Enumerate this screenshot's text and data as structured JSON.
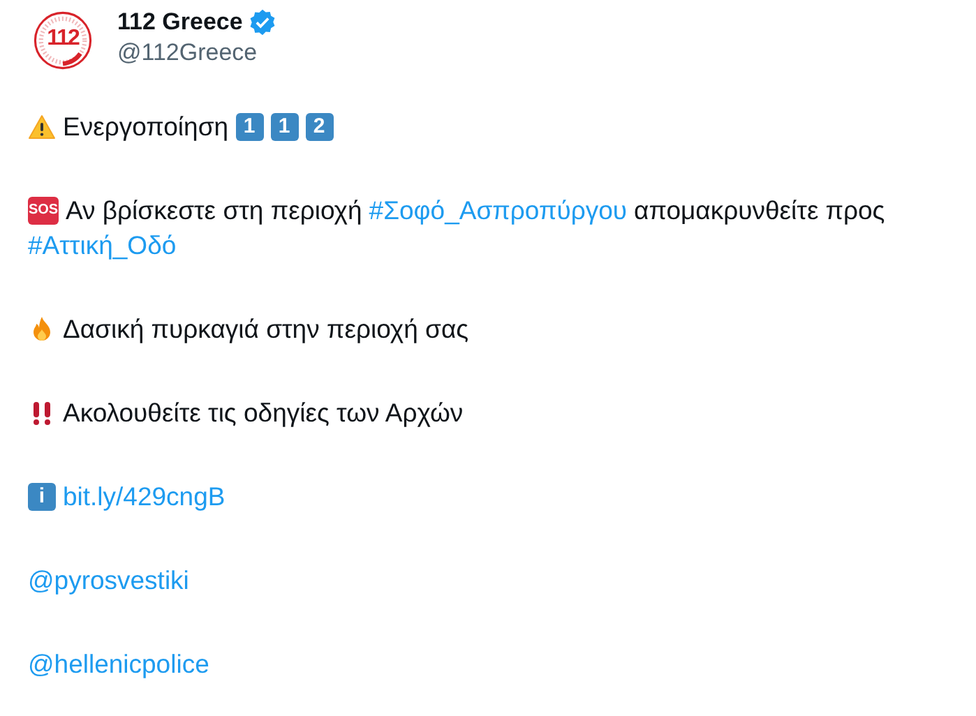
{
  "author": {
    "avatar_label": "112",
    "name": "112 Greece",
    "verified": true,
    "handle": "@112Greece"
  },
  "paragraphs": [
    {
      "segments": [
        {
          "kind": "warning"
        },
        {
          "kind": "text",
          "text": "Ενεργοποίηση"
        },
        {
          "kind": "keycap",
          "text": "1"
        },
        {
          "kind": "keycap",
          "text": "1"
        },
        {
          "kind": "keycap",
          "text": "2"
        }
      ]
    },
    {
      "segments": [
        {
          "kind": "sos",
          "text": "SOS"
        },
        {
          "kind": "text",
          "text": "Αν βρίσκεστε στη περιοχή"
        },
        {
          "kind": "link",
          "text": "#Σοφό_Ασπροπύργου"
        },
        {
          "kind": "text",
          "text": "απομακρυνθείτε"
        },
        {
          "kind": "text",
          "text": "προς"
        },
        {
          "kind": "link",
          "text": "#Αττική_Οδό"
        }
      ]
    },
    {
      "segments": [
        {
          "kind": "fire"
        },
        {
          "kind": "text",
          "text": "Δασική πυρκαγιά στην περιοχή σας"
        }
      ]
    },
    {
      "segments": [
        {
          "kind": "bangbang"
        },
        {
          "kind": "text",
          "text": "Ακολουθείτε τις οδηγίες των Αρχών"
        }
      ]
    },
    {
      "segments": [
        {
          "kind": "info",
          "text": "i"
        },
        {
          "kind": "link",
          "text": "bit.ly/429cngB"
        }
      ]
    },
    {
      "segments": [
        {
          "kind": "link",
          "text": "@pyrosvestiki"
        }
      ]
    },
    {
      "segments": [
        {
          "kind": "link",
          "text": "@hellenicpolice"
        }
      ]
    }
  ]
}
